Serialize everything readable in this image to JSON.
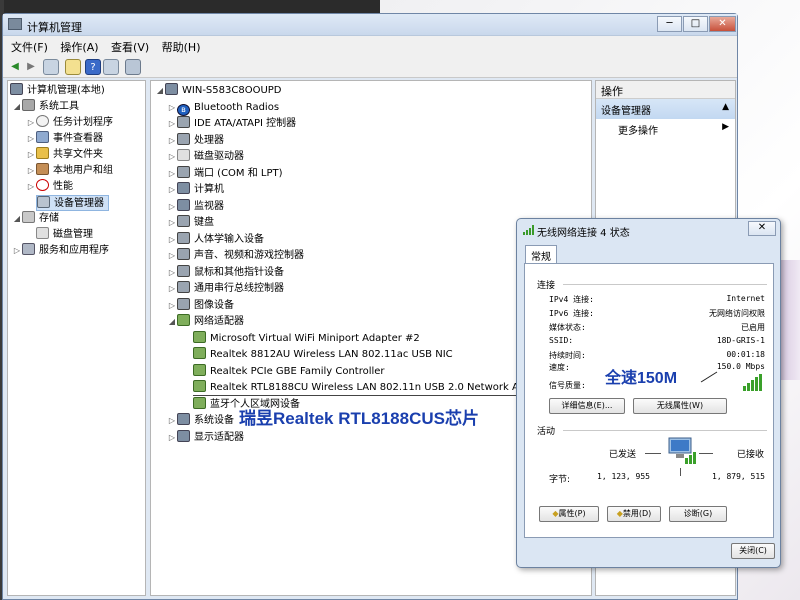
{
  "window": {
    "title": "计算机管理",
    "controls": {
      "minimize": "─",
      "maximize": "□",
      "close": "✕"
    }
  },
  "menu": [
    "文件(F)",
    "操作(A)",
    "查看(V)",
    "帮助(H)"
  ],
  "left_tree": {
    "root": "计算机管理(本地)",
    "system_tools": "系统工具",
    "task_scheduler": "任务计划程序",
    "event_viewer": "事件查看器",
    "shared_folders": "共享文件夹",
    "local_users": "本地用户和组",
    "performance": "性能",
    "device_manager": "设备管理器",
    "storage": "存储",
    "disk_management": "磁盘管理",
    "services_apps": "服务和应用程序"
  },
  "device_tree": {
    "root": "WIN-S583C8OOUPD",
    "bluetooth": "Bluetooth Radios",
    "ide": "IDE ATA/ATAPI 控制器",
    "cpu": "处理器",
    "disk_drives": "磁盘驱动器",
    "ports": "端口 (COM 和 LPT)",
    "computer": "计算机",
    "monitors": "监视器",
    "keyboards": "键盘",
    "hid": "人体学输入设备",
    "sound": "声音、视频和游戏控制器",
    "mice": "鼠标和其他指针设备",
    "usb": "通用串行总线控制器",
    "imaging": "图像设备",
    "network": "网络适配器",
    "adapter1": "Microsoft Virtual WiFi Miniport Adapter #2",
    "adapter2": "Realtek 8812AU Wireless LAN 802.11ac USB NIC",
    "adapter3": "Realtek PCIe GBE Family Controller",
    "adapter4": "Realtek RTL8188CU Wireless LAN 802.11n USB 2.0 Network Adapter",
    "adapter5": "蓝牙个人区域网设备",
    "system_devices": "系统设备",
    "display": "显示适配器"
  },
  "actions": {
    "header": "操作",
    "section": "设备管理器",
    "more": "更多操作"
  },
  "dialog": {
    "title": "无线网络连接 4 状态",
    "tab": "常规",
    "connection_group": "连接",
    "ipv4_label": "IPv4 连接:",
    "ipv4_value": "Internet",
    "ipv6_label": "IPv6 连接:",
    "ipv6_value": "无网络访问权限",
    "media_label": "媒体状态:",
    "media_value": "已启用",
    "ssid_label": "SSID:",
    "ssid_value": "18D-GRIS-1",
    "duration_label": "持续时间:",
    "duration_value": "00:01:18",
    "speed_label": "速度:",
    "speed_value": "150.0 Mbps",
    "signal_label": "信号质量:",
    "details_button": "详细信息(E)...",
    "wireless_props_button": "无线属性(W)",
    "activity_group": "活动",
    "sent_label": "已发送",
    "received_label": "已接收",
    "bytes_label": "字节:",
    "bytes_sent": "1, 123, 955",
    "bytes_received": "1, 879, 515",
    "properties_button": "属性(P)",
    "disable_button": "禁用(D)",
    "diagnose_button": "诊断(G)",
    "close_button": "关闭(C)",
    "close_x": "✕"
  },
  "annotations": {
    "speed_note": "全速150M",
    "chip_note": "瑞昱Realtek RTL8188CUS芯片"
  }
}
